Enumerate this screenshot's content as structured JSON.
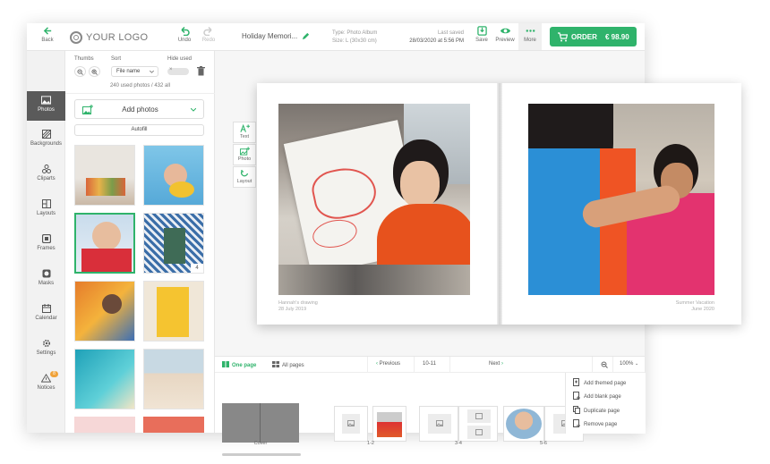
{
  "toolbar": {
    "back": "Back",
    "logo": "YOUR LOGO",
    "undo": "Undo",
    "redo": "Redo",
    "project_title": "Holiday Memori...",
    "type_line": "Type: Photo Album",
    "size_line": "Size: L (30x30 cm)",
    "last_saved_label": "Last saved",
    "last_saved_value": "28/03/2020 at 5:56 PM",
    "save": "Save",
    "preview": "Preview",
    "more": "More",
    "order": "ORDER",
    "price": "€ 98.90"
  },
  "rail": [
    {
      "label": "Photos",
      "icon": "photo-icon"
    },
    {
      "label": "Backgrounds",
      "icon": "backgrounds-icon"
    },
    {
      "label": "Cliparts",
      "icon": "cliparts-icon"
    },
    {
      "label": "Layouts",
      "icon": "layouts-icon"
    },
    {
      "label": "Frames",
      "icon": "frames-icon"
    },
    {
      "label": "Masks",
      "icon": "masks-icon"
    },
    {
      "label": "Calendar",
      "icon": "calendar-icon"
    },
    {
      "label": "Settings",
      "icon": "gear-icon"
    },
    {
      "label": "Notices",
      "icon": "warning-icon",
      "badge": "8"
    }
  ],
  "panel": {
    "thumbs_label": "Thumbs",
    "sort_label": "Sort",
    "hide_used_label": "Hide used",
    "sort_value": "File name",
    "counts": "240 used photos / 432 all",
    "add_photos": "Add photos",
    "autofill": "Autofill",
    "thumb_badge": "4"
  },
  "page_tools": [
    {
      "label": "Text",
      "icon": "text-add-icon"
    },
    {
      "label": "Photo",
      "icon": "photo-add-icon"
    },
    {
      "label": "Layout",
      "icon": "refresh-layout-icon"
    }
  ],
  "spread": {
    "left_caption_title": "Hannah's drawing",
    "left_caption_date": "28 July 2019",
    "right_caption_title": "Summer Vacation",
    "right_caption_date": "June 2020"
  },
  "bottom": {
    "one_page": "One page",
    "all_pages": "All pages",
    "previous": "Previous",
    "current": "10-11",
    "next": "Next",
    "zoom": "100%",
    "pages": [
      {
        "label": "Cover"
      },
      {
        "label": "1-2"
      },
      {
        "label": "3-4"
      },
      {
        "label": "5-6"
      }
    ]
  },
  "page_menu": [
    {
      "label": "Add themed page",
      "icon": "themed-page-icon"
    },
    {
      "label": "Add blank page",
      "icon": "blank-page-icon"
    },
    {
      "label": "Duplicate page",
      "icon": "duplicate-icon"
    },
    {
      "label": "Remove page",
      "icon": "remove-page-icon"
    }
  ],
  "colors": {
    "accent": "#2fb36b",
    "rail_active": "#5a5a5a",
    "badge": "#f0a33a"
  }
}
